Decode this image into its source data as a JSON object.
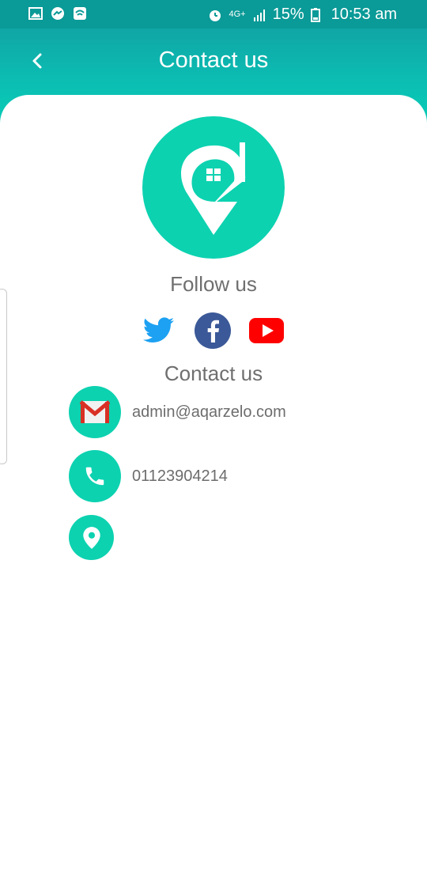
{
  "status_bar": {
    "network": "4G+",
    "battery": "15%",
    "time": "10:53 am",
    "icons": [
      "gallery-icon",
      "messenger-icon",
      "wifi-calling-icon",
      "alarm-icon",
      "signal-icon",
      "battery-icon"
    ]
  },
  "header": {
    "title": "Contact us",
    "back_icon": "chevron-left-icon"
  },
  "logo": {
    "name": "aqarzelo-logo"
  },
  "follow": {
    "title": "Follow us",
    "links": [
      {
        "name": "twitter",
        "icon": "twitter-icon",
        "color": "#1da1f2"
      },
      {
        "name": "facebook",
        "icon": "facebook-icon",
        "color": "#3b5998"
      },
      {
        "name": "youtube",
        "icon": "youtube-icon",
        "color": "#ff0000"
      }
    ]
  },
  "contact": {
    "title": "Contact us",
    "email": "admin@aqarzelo.com",
    "phone": "01123904214",
    "location": ""
  },
  "colors": {
    "accent": "#0cd2b0",
    "header_top": "#0a9a97",
    "text_gray": "#6f6f6f"
  }
}
